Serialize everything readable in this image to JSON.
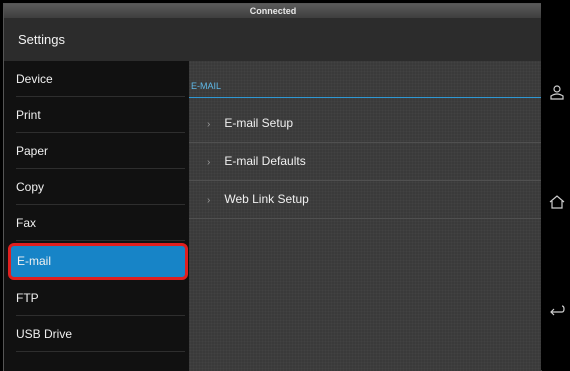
{
  "status": {
    "text": "Connected"
  },
  "title_bar": {
    "title": "Settings"
  },
  "sidebar": {
    "items": [
      {
        "label": "Device"
      },
      {
        "label": "Print"
      },
      {
        "label": "Paper"
      },
      {
        "label": "Copy"
      },
      {
        "label": "Fax"
      },
      {
        "label": "E-mail"
      },
      {
        "label": "FTP"
      },
      {
        "label": "USB Drive"
      }
    ],
    "selected": "E-mail"
  },
  "content": {
    "section_header": "E-MAIL",
    "items": [
      {
        "label": "E-mail Setup"
      },
      {
        "label": "E-mail Defaults"
      },
      {
        "label": "Web Link Setup"
      }
    ]
  },
  "nav_bar": {
    "icons": [
      "profile-icon",
      "home-icon",
      "back-icon"
    ]
  },
  "colors": {
    "accent": "#1784c7",
    "highlight_border": "#e01f1f",
    "header_text": "#5fb9e8"
  }
}
